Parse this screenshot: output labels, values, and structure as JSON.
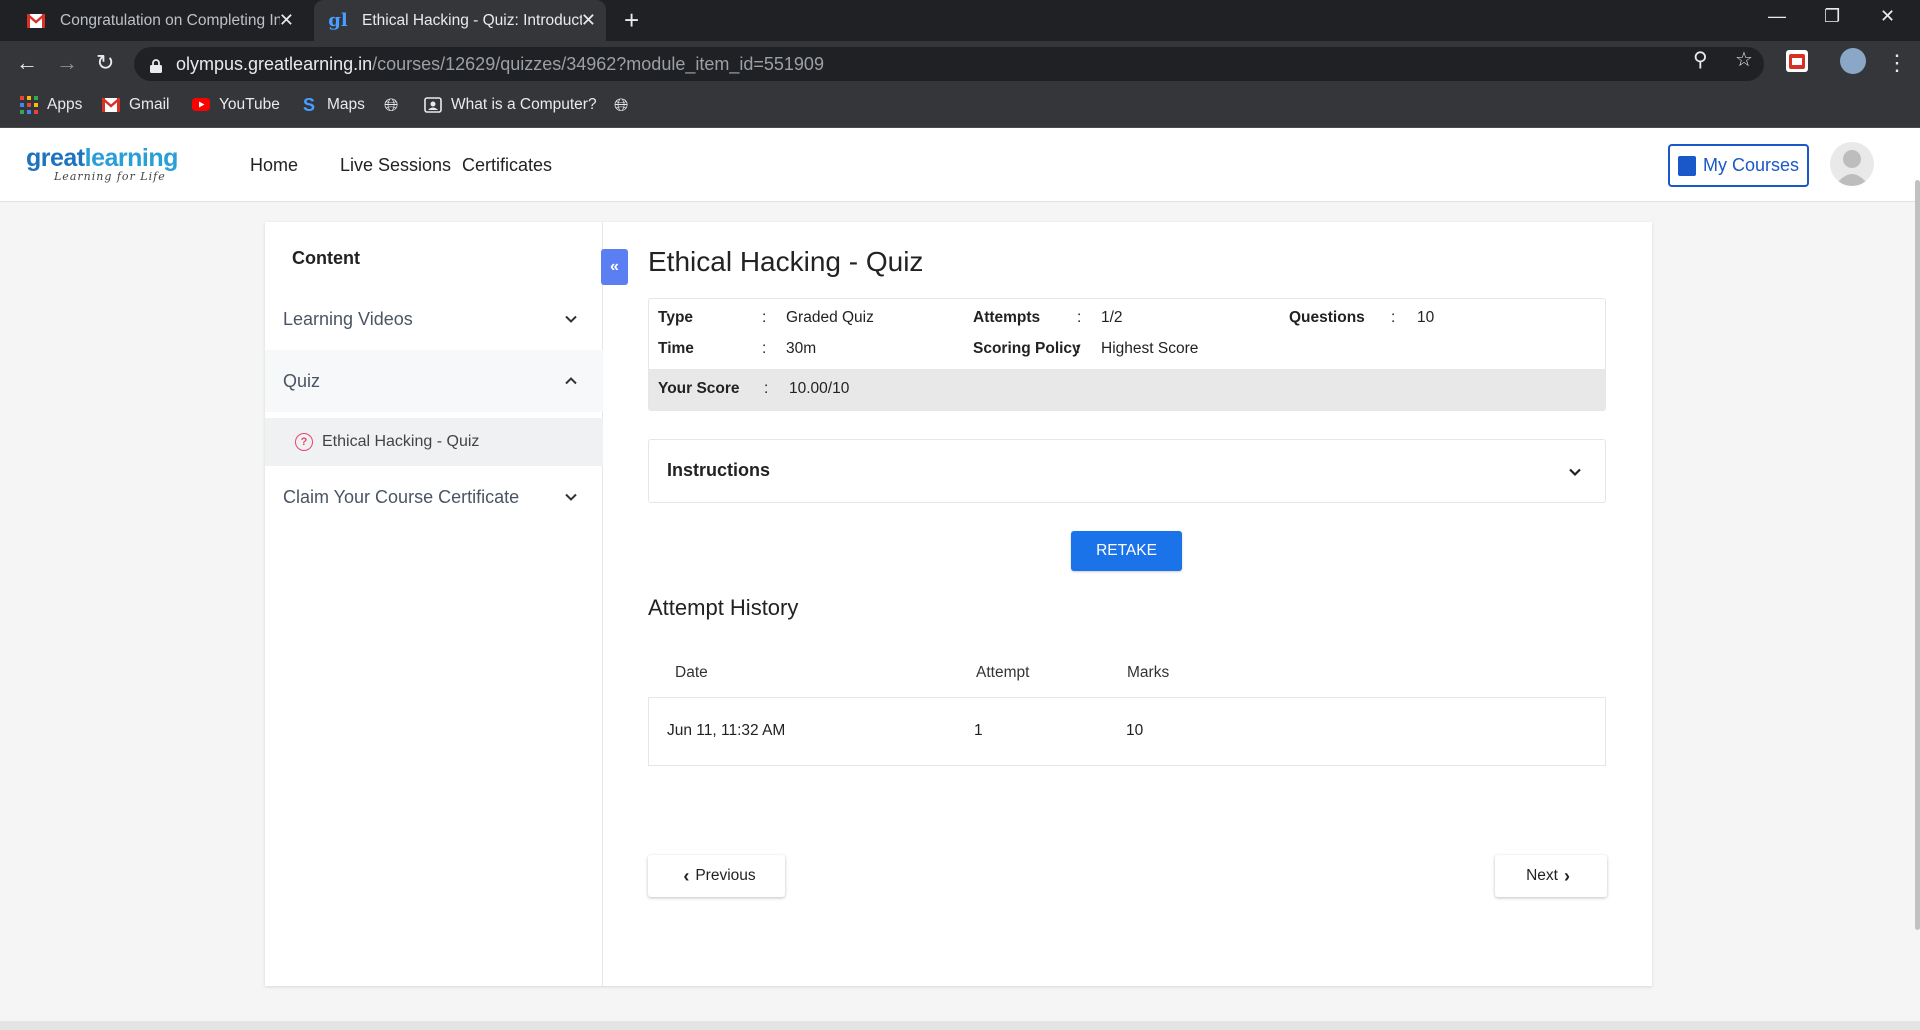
{
  "browser": {
    "tabs": [
      {
        "title": "Congratulation on Completing In",
        "icon": "gmail-icon",
        "active": false
      },
      {
        "title": "Ethical Hacking - Quiz: Introducti",
        "icon": "greatlearning-icon",
        "active": true
      }
    ],
    "url_host": "olympus.greatlearning.in",
    "url_path": "/courses/12629/quizzes/34962?module_item_id=551909",
    "bookmarks": [
      {
        "label": "Apps",
        "icon": "apps-grid-icon"
      },
      {
        "label": "Gmail",
        "icon": "gmail-icon"
      },
      {
        "label": "YouTube",
        "icon": "youtube-icon"
      },
      {
        "label": "Maps",
        "icon": "maps-icon"
      },
      {
        "label": "",
        "icon": "globe-icon"
      },
      {
        "label": "What is a Computer?",
        "icon": "page-icon"
      },
      {
        "label": "",
        "icon": "globe-icon"
      }
    ]
  },
  "site": {
    "logo_main_a": "great",
    "logo_main_b": "learning",
    "logo_sub": "Learning for Life",
    "nav": [
      "Home",
      "Live Sessions",
      "Certificates"
    ],
    "my_courses": "My Courses",
    "brand_color": "#1a57c8"
  },
  "sidebar": {
    "title": "Content",
    "sections": [
      {
        "label": "Learning Videos",
        "expanded": false
      },
      {
        "label": "Quiz",
        "expanded": true,
        "items": [
          "Ethical Hacking - Quiz"
        ]
      },
      {
        "label": "Claim Your Course Certificate",
        "expanded": false
      }
    ]
  },
  "quiz": {
    "title": "Ethical Hacking - Quiz",
    "type_label": "Type",
    "type_value": "Graded Quiz",
    "attempts_label": "Attempts",
    "attempts_value": "1/2",
    "questions_label": "Questions",
    "questions_value": "10",
    "time_label": "Time",
    "time_value": "30m",
    "policy_label": "Scoring Policy",
    "policy_value": "Highest Score",
    "score_label": "Your Score",
    "score_value": "10.00/10",
    "instructions_label": "Instructions",
    "retake_label": "RETAKE"
  },
  "history": {
    "title": "Attempt History",
    "columns": [
      "Date",
      "Attempt",
      "Marks"
    ],
    "rows": [
      {
        "date": "Jun 11, 11:32 AM",
        "attempt": "1",
        "marks": "10"
      }
    ]
  },
  "pager": {
    "previous": "Previous",
    "next": "Next"
  }
}
